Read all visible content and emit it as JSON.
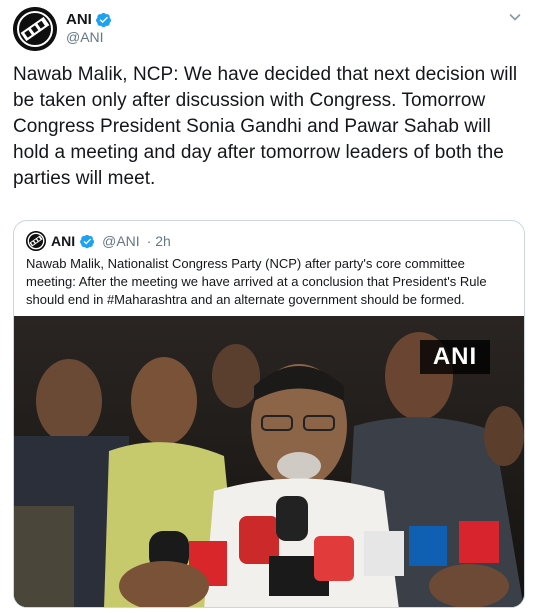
{
  "tweet": {
    "author_name": "ANI",
    "author_handle": "@ANI",
    "text": "Nawab Malik, NCP: We have decided that next decision will be taken only after discussion with Congress. Tomorrow Congress President Sonia Gandhi and Pawar Sahab will hold a meeting and day after tomorrow leaders of both the parties will meet."
  },
  "quoted": {
    "author_name": "ANI",
    "author_handle": "@ANI",
    "time": "· 2h",
    "text": "Nawab Malik, Nationalist Congress Party (NCP) after party's core committee meeting: After the meeting we have arrived at a conclusion that President's Rule should end in #Maharashtra and an alternate government should be formed.",
    "media_watermark": "ANI"
  },
  "icons": {
    "verified": "verified-badge-icon",
    "menu": "chevron-down-icon"
  },
  "colors": {
    "verified": "#1da1f2",
    "secondary_text": "#657786",
    "border": "#ccd6dd"
  }
}
